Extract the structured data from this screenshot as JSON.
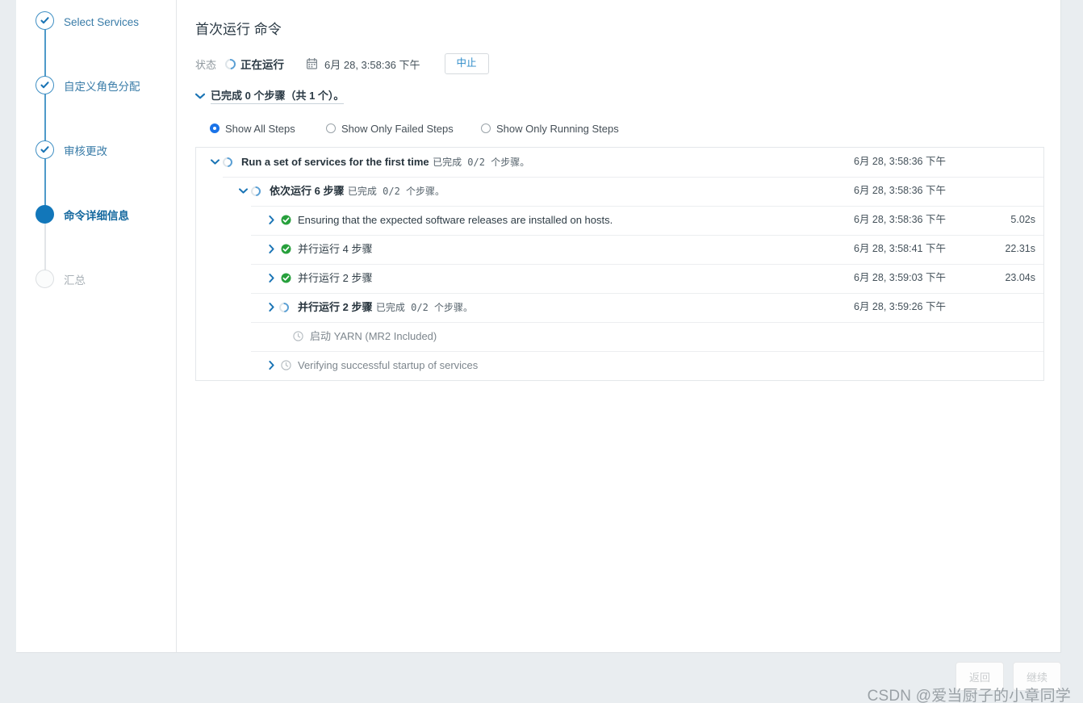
{
  "sidebar": {
    "steps": [
      {
        "label": "Select Services",
        "state": "done",
        "icon": "check-circle-icon"
      },
      {
        "label": "自定义角色分配",
        "state": "done",
        "icon": "check-circle-icon"
      },
      {
        "label": "审核更改",
        "state": "done",
        "icon": "check-circle-icon"
      },
      {
        "label": "命令详细信息",
        "state": "current",
        "icon": "filled-circle-icon"
      },
      {
        "label": "汇总",
        "state": "todo",
        "icon": "empty-circle-icon"
      }
    ]
  },
  "header": {
    "title": "首次运行 命令",
    "status_label": "状态",
    "status_value": "正在运行",
    "status_icon": "spinner-icon",
    "calendar_icon": "calendar-icon",
    "start_time": "6月 28, 3:58:36 下午",
    "abort_label": "中止",
    "summary_text": "已完成 0 个步骤（共 1 个）。",
    "summary_chevron": "chevron-down-icon"
  },
  "filters": {
    "options": [
      {
        "label": "Show All Steps",
        "selected": true
      },
      {
        "label": "Show Only Failed Steps",
        "selected": false
      },
      {
        "label": "Show Only Running Steps",
        "selected": false
      }
    ]
  },
  "steps": [
    {
      "name": "Run a set of services for the first time",
      "sub": "已完成 0/2 个步骤。",
      "time": "6月 28, 3:58:36 下午",
      "duration": "",
      "status_icon": "spinner-icon",
      "chevron": "chevron-down-icon",
      "indent": 0,
      "bold": true
    },
    {
      "name": "依次运行 6 步骤",
      "sub": "已完成 0/2 个步骤。",
      "time": "6月 28, 3:58:36 下午",
      "duration": "",
      "status_icon": "spinner-icon",
      "chevron": "chevron-down-icon",
      "indent": 1,
      "bold": true
    },
    {
      "name": "Ensuring that the expected software releases are installed on hosts.",
      "sub": "",
      "time": "6月 28, 3:58:36 下午",
      "duration": "5.02s",
      "status_icon": "check-circle-green-icon",
      "chevron": "chevron-right-icon",
      "indent": 2,
      "bold": false
    },
    {
      "name": "并行运行 4 步骤",
      "sub": "",
      "time": "6月 28, 3:58:41 下午",
      "duration": "22.31s",
      "status_icon": "check-circle-green-icon",
      "chevron": "chevron-right-icon",
      "indent": 2,
      "bold": false
    },
    {
      "name": "并行运行 2 步骤",
      "sub": "",
      "time": "6月 28, 3:59:03 下午",
      "duration": "23.04s",
      "status_icon": "check-circle-green-icon",
      "chevron": "chevron-right-icon",
      "indent": 2,
      "bold": false
    },
    {
      "name": "并行运行 2 步骤",
      "sub": "已完成 0/2 个步骤。",
      "time": "6月 28, 3:59:26 下午",
      "duration": "",
      "status_icon": "spinner-icon",
      "chevron": "chevron-right-icon",
      "indent": 2,
      "bold": true
    },
    {
      "name": "启动 YARN (MR2 Included)",
      "sub": "",
      "time": "",
      "duration": "",
      "status_icon": "clock-icon",
      "chevron": "none",
      "indent": 3,
      "bold": false,
      "muted": true
    },
    {
      "name": "Verifying successful startup of services",
      "sub": "",
      "time": "",
      "duration": "",
      "status_icon": "clock-icon",
      "chevron": "chevron-right-icon",
      "indent": 2,
      "bold": false,
      "muted": true
    }
  ],
  "footer": {
    "back_label": "返回",
    "continue_label": "继续",
    "watermark": "CSDN @爱当厨子的小章同学"
  },
  "colors": {
    "accent_blue": "#1277ba",
    "link_blue": "#2c8bc8",
    "success_green": "#27a03c",
    "panel_bg": "#ffffff",
    "page_bg": "#e9edf0"
  }
}
